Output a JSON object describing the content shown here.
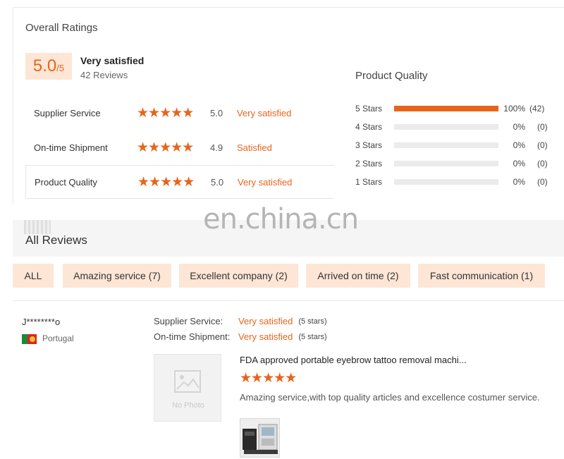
{
  "overall": {
    "title": "Overall Ratings",
    "score": "5.0",
    "score_unit": "/5",
    "score_label": "Very satisfied",
    "reviews_count": "42 Reviews"
  },
  "ratings": [
    {
      "name": "Supplier Service",
      "stars": "★★★★★",
      "value": "5.0",
      "label": "Very satisfied"
    },
    {
      "name": "On-time Shipment",
      "stars": "★★★★★",
      "value": "4.9",
      "label": "Satisfied"
    },
    {
      "name": "Product Quality",
      "stars": "★★★★★",
      "value": "5.0",
      "label": "Very satisfied"
    }
  ],
  "product_quality": {
    "title": "Product Quality",
    "rows": [
      {
        "label": "5 Stars",
        "percent_text": "100%",
        "count": "(42)",
        "fraction": 1.0
      },
      {
        "label": "4 Stars",
        "percent_text": "0%",
        "count": "(0)",
        "fraction": 0
      },
      {
        "label": "3 Stars",
        "percent_text": "0%",
        "count": "(0)",
        "fraction": 0
      },
      {
        "label": "2 Stars",
        "percent_text": "0%",
        "count": "(0)",
        "fraction": 0
      },
      {
        "label": "1 Stars",
        "percent_text": "0%",
        "count": "(0)",
        "fraction": 0
      }
    ]
  },
  "watermark": "en.china.cn",
  "all_reviews": {
    "title": "All Reviews",
    "filters": [
      "ALL",
      "Amazing service (7)",
      "Excellent company (2)",
      "Arrived on time (2)",
      "Fast communication (1)"
    ]
  },
  "review": {
    "reviewer": "J********o",
    "country": "Portugal",
    "supplier_service_label": "Supplier Service:",
    "supplier_service_value": "Very satisfied",
    "supplier_service_stars": "(5 stars)",
    "shipment_label": "On-time Shipment:",
    "shipment_value": "Very satisfied",
    "shipment_stars": "(5 stars)",
    "no_photo": "No Photo",
    "product_title": "FDA approved portable eyebrow tattoo removal machi...",
    "stars": "★★★★★",
    "text": "Amazing service,with top quality articles and excellence costumer service."
  },
  "colors": {
    "accent": "#e8641a",
    "accent_bg": "#fde6d6"
  }
}
